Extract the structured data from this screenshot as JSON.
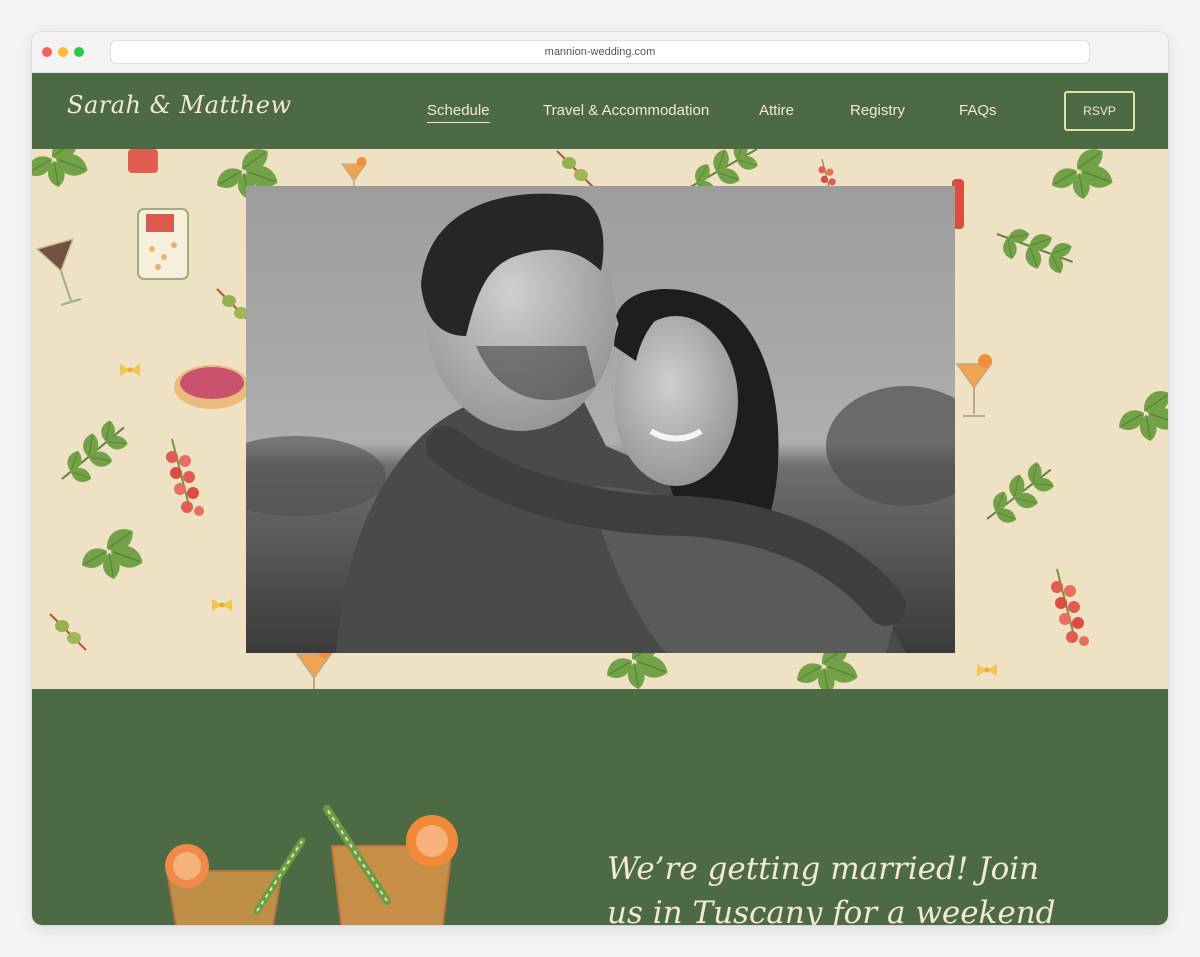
{
  "browser": {
    "url": "mannion-wedding.com"
  },
  "header": {
    "logo": "Sarah & Matthew",
    "nav": [
      {
        "label": "Schedule",
        "active": true
      },
      {
        "label": "Travel & Accommodation",
        "active": false
      },
      {
        "label": "Attire",
        "active": false
      },
      {
        "label": "Registry",
        "active": false
      },
      {
        "label": "FAQs",
        "active": false
      }
    ],
    "rsvp_label": "RSVP"
  },
  "intro": {
    "tagline": "We’re getting married!  Join us in Tuscany for a weekend of"
  },
  "colors": {
    "brand_green": "#4c6a44",
    "cream": "#f3e9d4",
    "pattern_background": "#efe1c4"
  },
  "icons": {
    "window_controls": [
      "close-icon",
      "minimize-icon",
      "zoom-icon"
    ],
    "hero_pattern": [
      "basil-icon",
      "olive-branch-icon",
      "cherry-tomato-icon",
      "cocktail-icon",
      "pasta-icon"
    ],
    "intro_illustration": "spritz-cocktails-icon"
  }
}
